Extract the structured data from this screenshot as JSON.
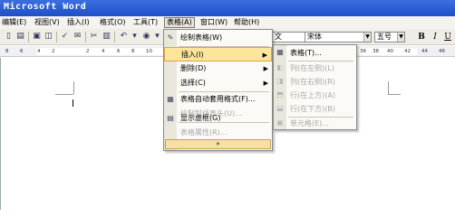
{
  "window": {
    "title": "Microsoft Word"
  },
  "menubar": {
    "items": [
      "编辑(E)",
      "视图(V)",
      "插入(I)",
      "格式(O)",
      "工具(T)",
      "表格(A)",
      "窗口(W)",
      "帮助(H)"
    ],
    "active": "表格(A)"
  },
  "toolbar": {
    "font_name": "宋体",
    "style_partial": "文",
    "font_size": "五号",
    "bold": "B",
    "italic": "I",
    "underline": "U"
  },
  "ruler": {
    "numbers": [
      "8",
      "6",
      "4",
      "2",
      "2",
      "4",
      "6",
      "8",
      "10",
      "36",
      "38",
      "40",
      "42",
      "44",
      "46"
    ]
  },
  "table_menu": {
    "items": [
      {
        "label": "绘制表格(W)",
        "icon": "pencil-icon",
        "enabled": true,
        "submenu": false
      },
      {
        "label": "插入(I)",
        "icon": "",
        "enabled": true,
        "submenu": true,
        "highlighted": true
      },
      {
        "label": "删除(D)",
        "icon": "",
        "enabled": true,
        "submenu": true
      },
      {
        "label": "选择(C)",
        "icon": "",
        "enabled": true,
        "submenu": true
      },
      {
        "label": "表格自动套用格式(F)...",
        "icon": "autoformat-icon",
        "enabled": true,
        "submenu": false
      },
      {
        "label": "绘制斜线表头(U)...",
        "icon": "",
        "enabled": false,
        "submenu": false
      },
      {
        "label": "显示虚框(G)",
        "icon": "gridlines-icon",
        "enabled": true,
        "submenu": false
      },
      {
        "label": "表格属性(R)...",
        "icon": "",
        "enabled": false,
        "submenu": false
      }
    ],
    "expand_label": "»"
  },
  "insert_submenu": {
    "items": [
      {
        "label": "表格(T)...",
        "icon": "table-icon",
        "enabled": true
      },
      {
        "label": "列(在左侧)(L)",
        "icon": "insert-column-left-icon",
        "enabled": false
      },
      {
        "label": "列(在右侧)(R)",
        "icon": "insert-column-right-icon",
        "enabled": false
      },
      {
        "label": "行(在上方)(A)",
        "icon": "insert-row-above-icon",
        "enabled": false
      },
      {
        "label": "行(在下方)(B)",
        "icon": "insert-row-below-icon",
        "enabled": false
      },
      {
        "label": "单元格(E)...",
        "icon": "insert-cells-icon",
        "enabled": false
      }
    ]
  },
  "colors": {
    "titlebar": "#2a5bd7",
    "highlight": "#fde59b",
    "menu_bg": "#fbfaf6"
  }
}
